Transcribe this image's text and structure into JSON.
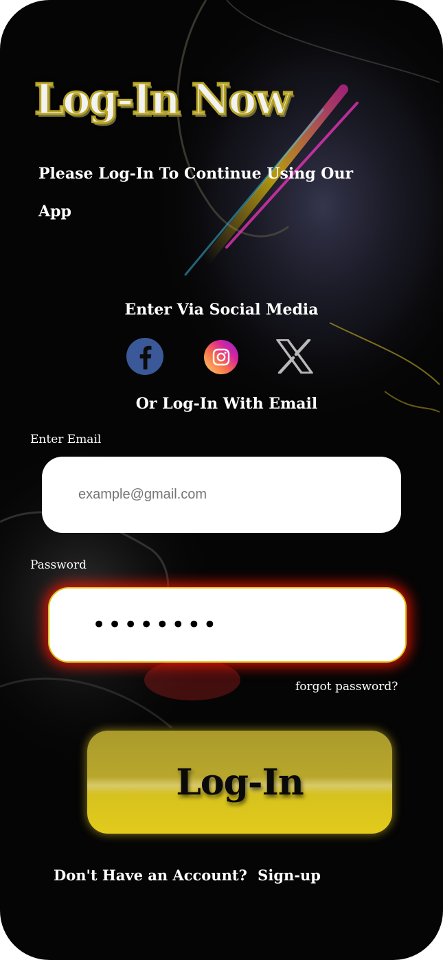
{
  "header": {
    "title": "Log-In Now",
    "subtitle": "Please Log-In To Continue Using Our App"
  },
  "social": {
    "heading": "Enter Via Social Media",
    "icons": [
      "facebook-icon",
      "instagram-icon",
      "x-icon"
    ]
  },
  "email_section": {
    "heading": "Or Log-In With Email",
    "email_label": "Enter Email",
    "email_placeholder": "example@gmail.com",
    "password_label": "Password",
    "password_value": "••••••••",
    "forgot_label": "forgot password?"
  },
  "actions": {
    "login_label": "Log-In",
    "signup_prompt": "Don't  Have an Account?",
    "signup_link": "Sign-up"
  },
  "colors": {
    "accent": "#d6c21f",
    "glow": "#e61400",
    "background": "#050505"
  }
}
